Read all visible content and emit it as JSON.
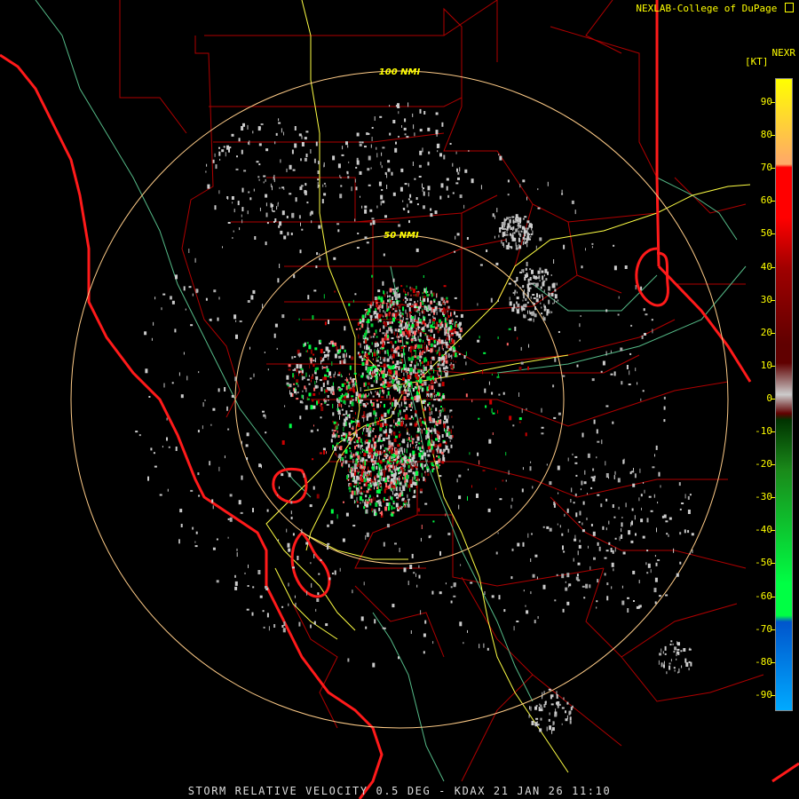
{
  "header": {
    "credit": "NEXLAB-College of DuPage",
    "product": "NEXR",
    "unit": "[KT]"
  },
  "rings": [
    {
      "label": "100 NMI"
    },
    {
      "label": "50 NMI"
    }
  ],
  "scale": {
    "labels": [
      "90",
      "80",
      "70",
      "60",
      "50",
      "40",
      "30",
      "20",
      "10",
      "0",
      "-10",
      "-20",
      "-30",
      "-40",
      "-50",
      "-60",
      "-70",
      "-80",
      "-90"
    ],
    "colors": [
      "#ffff00",
      "#ffaa66",
      "#ff0000",
      "#a00000",
      "#600000",
      "#cccccc",
      "#1a8a1a",
      "#00ff44",
      "#0055cc",
      "#00aaff"
    ]
  },
  "footer": {
    "caption": "STORM RELATIVE VELOCITY 0.5 DEG - KDAX 21 JAN 26 11:10"
  },
  "colors": {
    "state_border": "#ff1a1a",
    "county_border": "#b00000",
    "highway": "#ffff44",
    "river": "#66cc99",
    "range_ring": "#ffcc88"
  }
}
